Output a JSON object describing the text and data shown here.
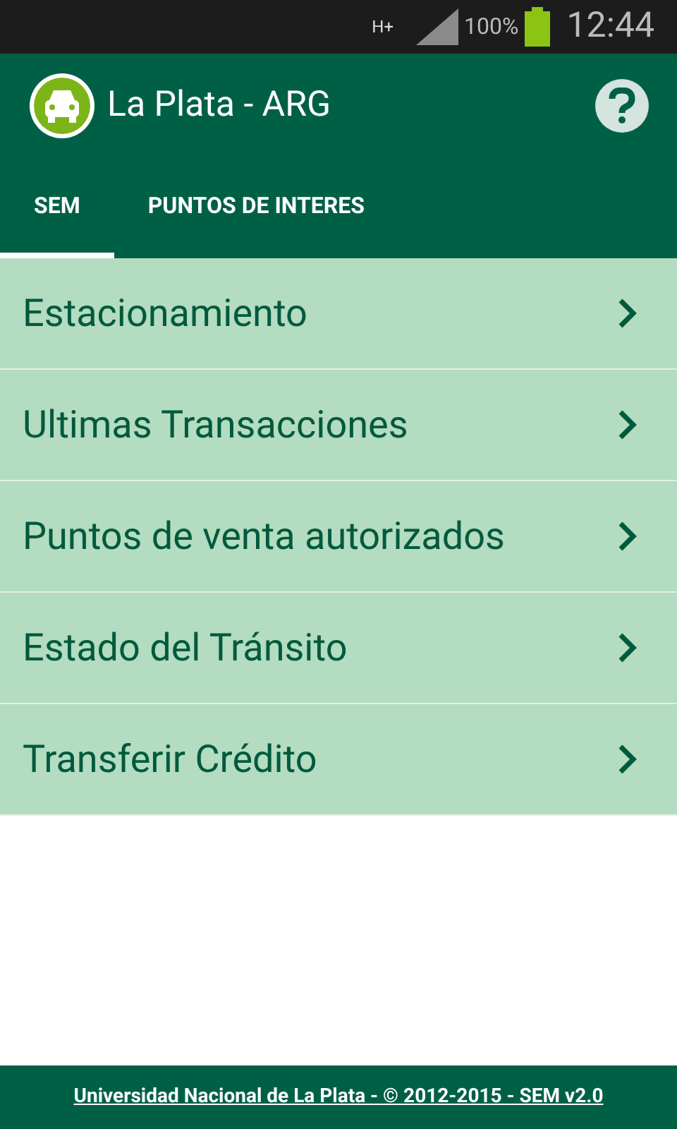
{
  "status_bar": {
    "network": "H+",
    "battery": "100%",
    "time": "12:44"
  },
  "app_bar": {
    "title": "La Plata - ARG"
  },
  "tabs": [
    {
      "label": "SEM",
      "selected": true
    },
    {
      "label": "PUNTOS DE INTERES",
      "selected": false
    }
  ],
  "menu": [
    {
      "label": "Estacionamiento"
    },
    {
      "label": "Ultimas Transacciones"
    },
    {
      "label": "Puntos de venta autorizados"
    },
    {
      "label": "Estado del Tránsito"
    },
    {
      "label": "Transferir Crédito"
    }
  ],
  "footer": {
    "link": "Universidad Nacional de La Plata - © 2012-2015 - SEM v2.0"
  }
}
